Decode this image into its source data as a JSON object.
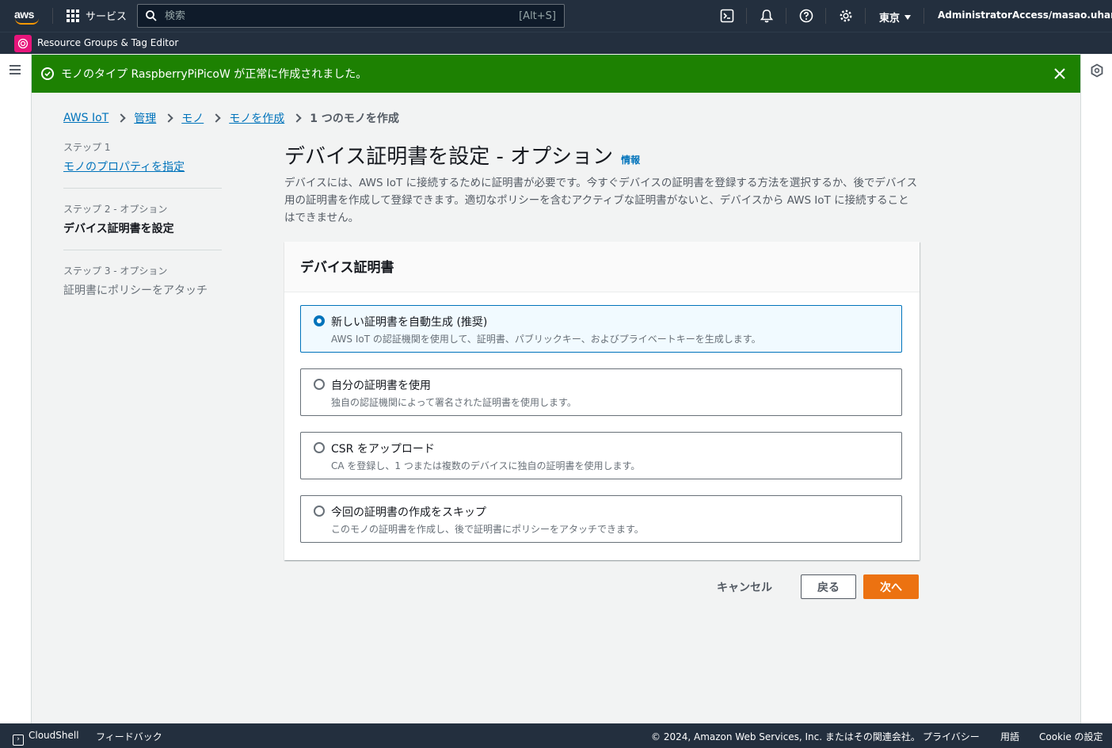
{
  "topnav": {
    "logo": "aws",
    "services_label": "サービス",
    "search_placeholder": "検索",
    "search_shortcut": "[Alt+S]",
    "region": "東京",
    "account": "AdministratorAccess/masao.uhara"
  },
  "subnav": {
    "pinned_service": "Resource Groups & Tag Editor"
  },
  "flash": {
    "message": "モノのタイプ RaspberryPiPicoW が正常に作成されました。",
    "color": "#1d8102"
  },
  "breadcrumb": [
    "AWS IoT",
    "管理",
    "モノ",
    "モノを作成",
    "1 つのモノを作成"
  ],
  "steps": [
    {
      "small": "ステップ 1",
      "label": "モノのプロパティを指定"
    },
    {
      "small": "ステップ 2 - オプション",
      "label": "デバイス証明書を設定"
    },
    {
      "small": "ステップ 3 - オプション",
      "label": "証明書にポリシーをアタッチ"
    }
  ],
  "page": {
    "title": "デバイス証明書を設定 - オプション",
    "info": "情報",
    "description": "デバイスには、AWS IoT に接続するために証明書が必要です。今すぐデバイスの証明書を登録する方法を選択するか、後でデバイス用の証明書を作成して登録できます。適切なポリシーを含むアクティブな証明書がないと、デバイスから AWS IoT に接続することはできません。"
  },
  "panel": {
    "header": "デバイス証明書",
    "options": [
      {
        "label": "新しい証明書を自動生成 (推奨)",
        "desc": "AWS IoT の認証機関を使用して、証明書、パブリックキー、およびプライベートキーを生成します。",
        "selected": true
      },
      {
        "label": "自分の証明書を使用",
        "desc": "独自の認証機関によって署名された証明書を使用します。",
        "selected": false
      },
      {
        "label": "CSR をアップロード",
        "desc": "CA を登録し、1 つまたは複数のデバイスに独自の証明書を使用します。",
        "selected": false
      },
      {
        "label": "今回の証明書の作成をスキップ",
        "desc": "このモノの証明書を作成し、後で証明書にポリシーをアタッチできます。",
        "selected": false
      }
    ]
  },
  "actions": {
    "cancel": "キャンセル",
    "back": "戻る",
    "next": "次へ"
  },
  "footer": {
    "cloudshell": "CloudShell",
    "feedback": "フィードバック",
    "copyright": "© 2024, Amazon Web Services, Inc. またはその関連会社。",
    "privacy": "プライバシー",
    "terms": "用語",
    "cookie": "Cookie の設定"
  },
  "colors": {
    "nav_bg": "#232f3e",
    "link": "#0073bb",
    "primary_button": "#ec7211",
    "flash_success": "#1d8102"
  },
  "icons": [
    "grid-icon",
    "search-icon",
    "cloudshell-icon",
    "bell-icon",
    "help-icon",
    "gear-icon",
    "resource-groups-icon",
    "menu-icon",
    "close-icon",
    "check-circle-icon"
  ]
}
